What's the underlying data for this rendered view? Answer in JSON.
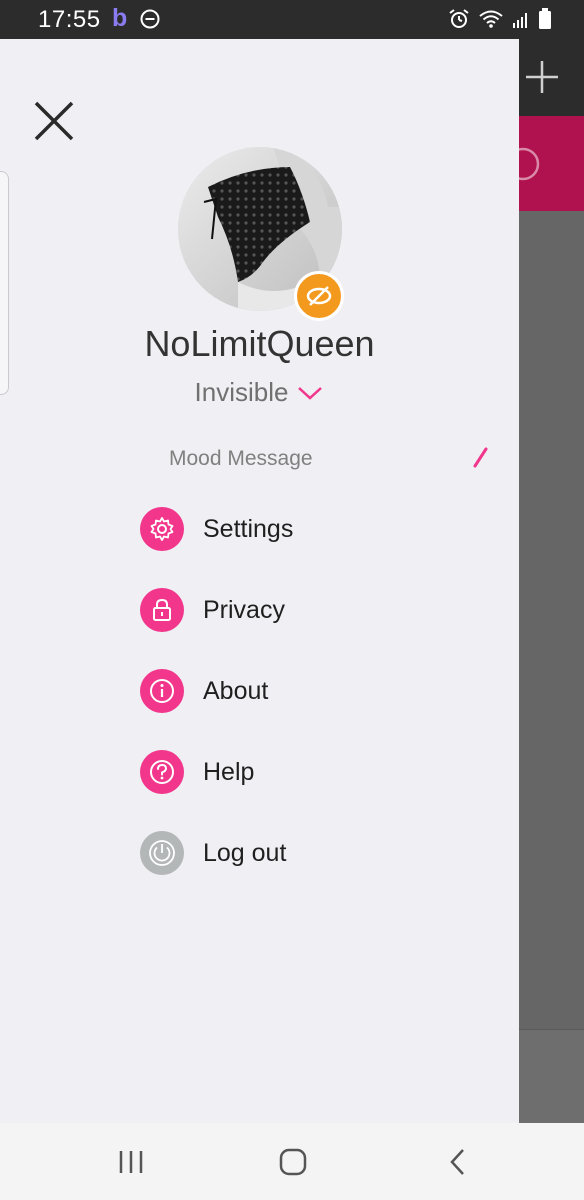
{
  "status_bar": {
    "time": "17:55",
    "app_indicator": "b",
    "icons": [
      "dnd-icon",
      "alarm-icon",
      "wifi-icon",
      "signal-icon",
      "battery-icon"
    ]
  },
  "drawer": {
    "username": "NoLimitQueen",
    "presence": "Invisible",
    "mood_message_label": "Mood Message",
    "menu": [
      {
        "label": "Settings",
        "icon": "gear-icon",
        "color": "#f1368b"
      },
      {
        "label": "Privacy",
        "icon": "lock-icon",
        "color": "#f1368b"
      },
      {
        "label": "About",
        "icon": "info-icon",
        "color": "#f1368b"
      },
      {
        "label": "Help",
        "icon": "question-icon",
        "color": "#f1368b"
      },
      {
        "label": "Log out",
        "icon": "power-icon",
        "color": "#b3b7b8"
      }
    ]
  },
  "colors": {
    "accent": "#f1368b",
    "badge": "#f39a1e",
    "drawer_bg": "#f0eff4",
    "background_pink": "#b0124f"
  }
}
